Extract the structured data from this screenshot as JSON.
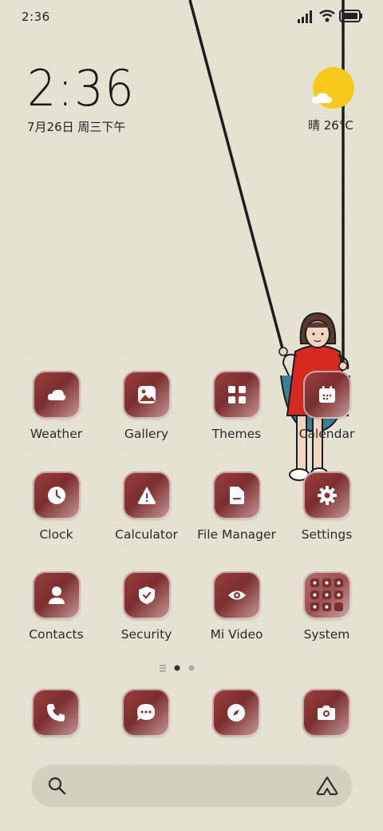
{
  "status_bar": {
    "time": "2:36",
    "icons": [
      "signal-icon",
      "wifi-icon",
      "battery-icon"
    ]
  },
  "clock_widget": {
    "time": "2:36",
    "date": "7月26日 周三下午"
  },
  "weather_widget": {
    "condition_icon": "sun-cloud-icon",
    "text": "晴 26°C"
  },
  "apps": [
    {
      "label": "Weather",
      "icon": "cloud-icon"
    },
    {
      "label": "Gallery",
      "icon": "picture-icon"
    },
    {
      "label": "Themes",
      "icon": "grid-icon"
    },
    {
      "label": "Calendar",
      "icon": "calendar-icon"
    },
    {
      "label": "Clock",
      "icon": "clock-icon"
    },
    {
      "label": "Calculator",
      "icon": "warning-icon"
    },
    {
      "label": "File Manager",
      "icon": "folder-icon"
    },
    {
      "label": "Settings",
      "icon": "gear-icon"
    },
    {
      "label": "Contacts",
      "icon": "person-icon"
    },
    {
      "label": "Security",
      "icon": "shield-icon"
    },
    {
      "label": "Mi Video",
      "icon": "eye-icon"
    },
    {
      "label": "System",
      "icon": "folder-grid-icon"
    }
  ],
  "page_indicator": {
    "pages": 2,
    "current": 1
  },
  "dock": [
    {
      "icon": "phone-icon"
    },
    {
      "icon": "message-icon"
    },
    {
      "icon": "compass-icon"
    },
    {
      "icon": "camera-icon"
    }
  ],
  "search": {
    "left_icon": "search-icon",
    "right_icon": "assistant-icon"
  },
  "colors": {
    "background": "#e6e3d3",
    "icon_tile": "#8a3434",
    "sun": "#f7c91c",
    "text": "#2b2b2b"
  }
}
